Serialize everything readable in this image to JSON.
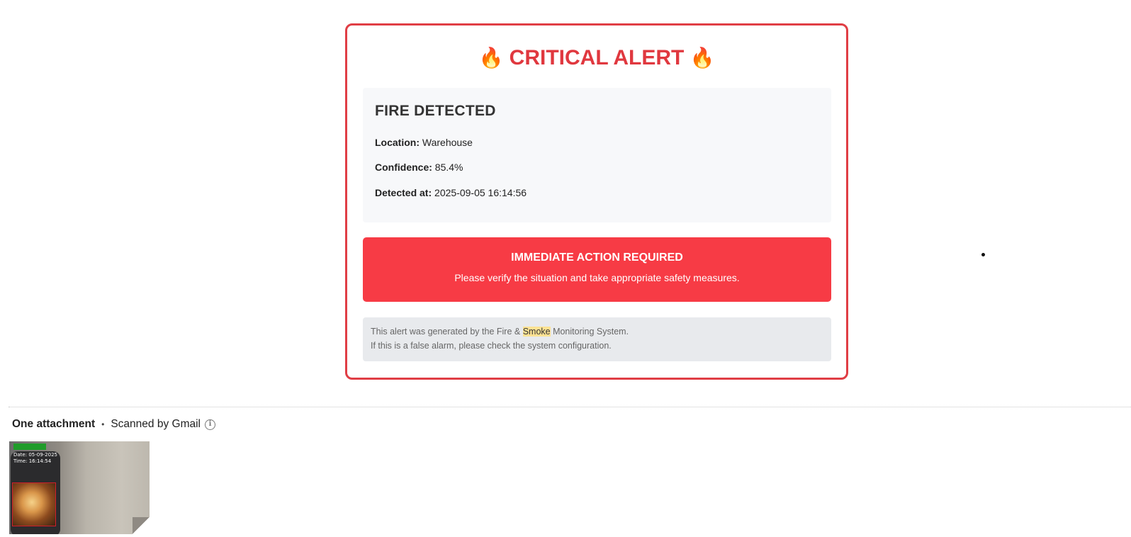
{
  "alert": {
    "title": "CRITICAL ALERT",
    "title_icon": "fire-icon",
    "details": {
      "heading": "FIRE DETECTED",
      "location_label": "Location:",
      "location_value": "Warehouse",
      "confidence_label": "Confidence:",
      "confidence_value": "85.4%",
      "detected_label": "Detected at:",
      "detected_value": "2025-09-05 16:14:56"
    },
    "action": {
      "heading": "IMMEDIATE ACTION REQUIRED",
      "text": "Please verify the situation and take appropriate safety measures."
    },
    "footer": {
      "line1_before": "This alert was generated by the Fire & ",
      "line1_highlight": "Smoke",
      "line1_after": " Monitoring System.",
      "line2": "If this is a false alarm, please check the system configuration."
    }
  },
  "attachments": {
    "count_label": "One attachment",
    "separator": "•",
    "scanned_label": "Scanned by Gmail",
    "info_icon": "info-icon",
    "thumbnail": {
      "date_text": "Date: 05-09-2025",
      "time_text": "Time: 16:14:54"
    }
  },
  "colors": {
    "alert_red": "#e03e45",
    "action_red": "#f73b45",
    "highlight": "#fde293"
  }
}
